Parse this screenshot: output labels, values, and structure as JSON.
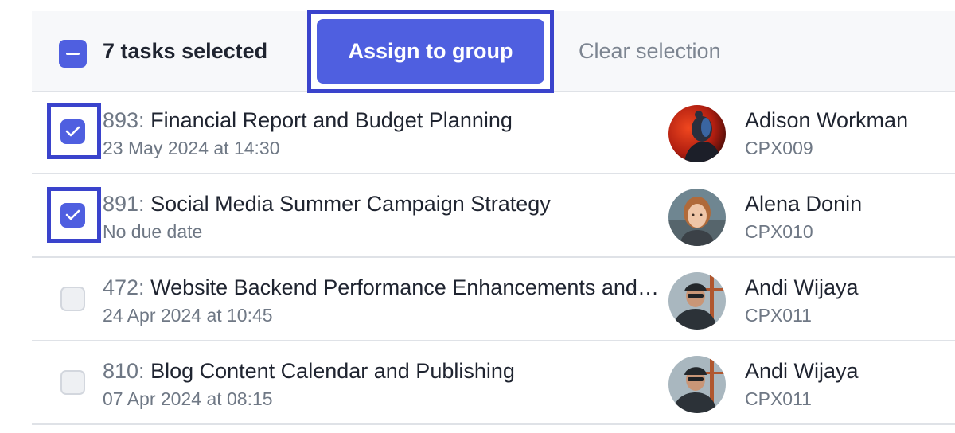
{
  "toolbar": {
    "selected_label": "7 tasks selected",
    "assign_label": "Assign to group",
    "clear_label": "Clear selection"
  },
  "tasks": [
    {
      "id_label": "893:",
      "title": "Financial Report and Budget Planning",
      "due": "23 May 2024 at 14:30",
      "checked": true,
      "assignee": {
        "name": "Adison Workman",
        "code": "CPX009",
        "avatar": "avatar-red-portrait"
      }
    },
    {
      "id_label": "891:",
      "title": "Social Media Summer Campaign Strategy",
      "due": "No due date",
      "checked": true,
      "assignee": {
        "name": "Alena Donin",
        "code": "CPX010",
        "avatar": "avatar-woman-portrait"
      }
    },
    {
      "id_label": "472:",
      "title": "Website Backend Performance Enhancements and Optimization",
      "due": "24 Apr 2024 at 10:45",
      "checked": false,
      "assignee": {
        "name": "Andi Wijaya",
        "code": "CPX011",
        "avatar": "avatar-cyclist-portrait"
      }
    },
    {
      "id_label": "810:",
      "title": "Blog Content Calendar and Publishing",
      "due": "07 Apr 2024 at 08:15",
      "checked": false,
      "assignee": {
        "name": "Andi Wijaya",
        "code": "CPX011",
        "avatar": "avatar-cyclist-portrait"
      }
    }
  ],
  "colors": {
    "accent": "#4f5fe0",
    "highlight": "#3a43cc",
    "text": "#1f2430",
    "muted": "#6f7885"
  }
}
